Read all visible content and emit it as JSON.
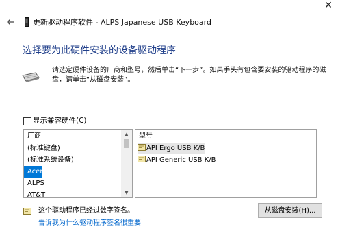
{
  "window": {
    "title": "更新驱动程序软件 - ALPS Japanese USB Keyboard",
    "close_glyph": "✕",
    "back_icon": "back-arrow-icon",
    "device_icon": "device-icon"
  },
  "heading": "选择要为此硬件安装的设备驱动程序",
  "instruction": "请选定硬件设备的厂商和型号，然后单击“下一步”。如果手头有包含要安装的驱动程序的磁盘，请单击“从磁盘安装”。",
  "show_compatible": {
    "label": "显示兼容硬件(C)",
    "checked": false
  },
  "manufacturer": {
    "header": "厂商",
    "items": [
      "(标准键盘)",
      "(标准系统设备)",
      "Acer",
      "ALPS",
      "AT&T"
    ],
    "selected": "Acer",
    "scroll_up": "▲",
    "scroll_down": "▼"
  },
  "model": {
    "header": "型号",
    "items": [
      "API Ergo USB K/B",
      "API Generic USB K/B"
    ],
    "selected": "API Ergo USB K/B"
  },
  "signature_text": "这个驱动程序已经过数字签名。",
  "why_link": "告诉我为什么驱动程序签名很重要",
  "have_disk_button": "从磁盘安装(H)...",
  "colors": {
    "heading": "#1f3e8a",
    "selection": "#0078d7",
    "link": "#0066cc"
  }
}
